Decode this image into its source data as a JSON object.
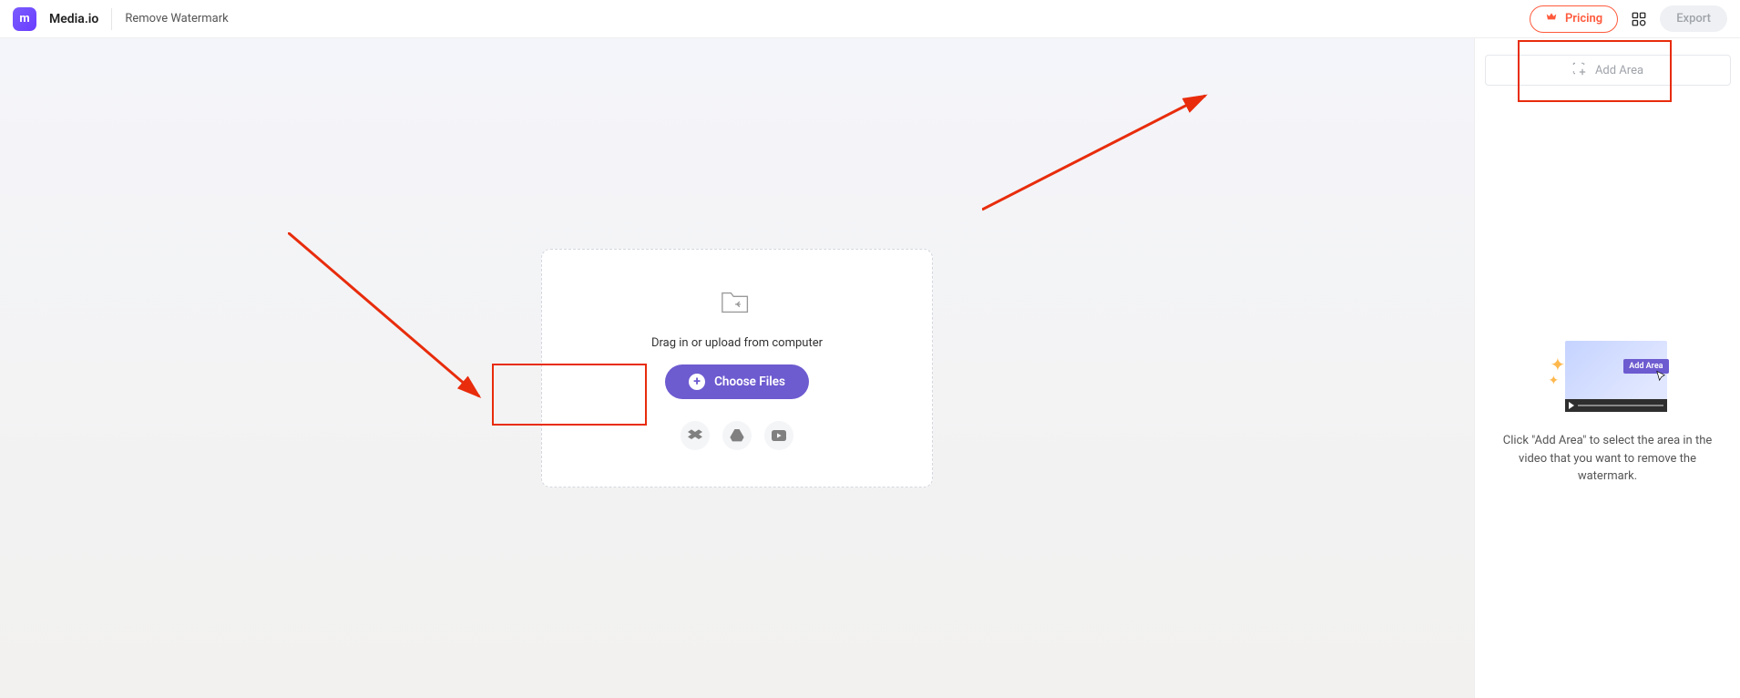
{
  "header": {
    "brand": "Media.io",
    "tool_name": "Remove Watermark",
    "pricing_label": "Pricing",
    "export_label": "Export"
  },
  "upload": {
    "hint": "Drag in or upload from computer",
    "button_label": "Choose Files"
  },
  "sidebar": {
    "add_area_label": "Add Area",
    "illustration_badge": "Add Area",
    "help_text": "Click \"Add Area\" to select the area in the video that you want to remove the watermark."
  }
}
